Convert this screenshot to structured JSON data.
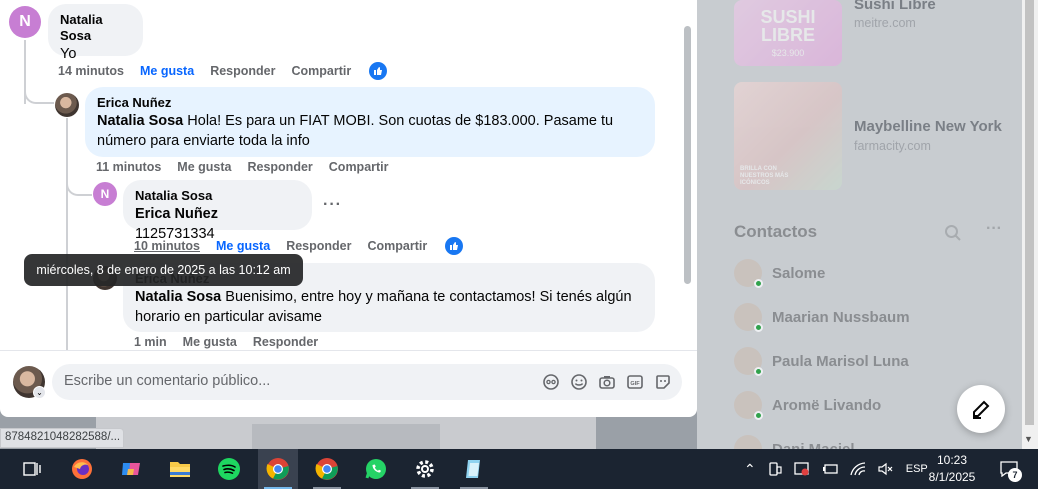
{
  "comments": [
    {
      "author": "Natalia Sosa",
      "avatar_letter": "N",
      "text": "Yo",
      "time": "14 minutos",
      "like": "Me gusta",
      "reply": "Responder",
      "share": "Compartir",
      "liked": true
    },
    {
      "author": "Erica Nuñez",
      "mention": "Natalia Sosa",
      "text": " Hola! Es para un FIAT MOBI. Son cuotas de $183.000. Pasame tu número para enviarte toda la info",
      "time": "11 minutos",
      "like": "Me gusta",
      "reply": "Responder",
      "share": "Compartir",
      "liked": false
    },
    {
      "author": "Natalia Sosa",
      "avatar_letter": "N",
      "mention": "Erica Nuñez",
      "text": " 1125731334",
      "time": "10 minutos",
      "like": "Me gusta",
      "reply": "Responder",
      "share": "Compartir",
      "liked": true,
      "more": "···"
    },
    {
      "author": "Erica Nuñez",
      "mention": "Natalia Sosa",
      "text": " Buenisimo, entre hoy y mañana te contactamos! Si tenés algún horario en particular avisame",
      "time": "1 min",
      "like": "Me gusta",
      "reply": "Responder",
      "liked": false
    }
  ],
  "tooltip": "miércoles, 8 de enero de 2025 a las 10:12 am",
  "composer": {
    "placeholder": "Escribe un comentario público..."
  },
  "status_url": "8784821048282588/...",
  "ads": [
    {
      "title": "Sushi Libre",
      "url": "meitre.com",
      "image_text": "SUSHI LIBRE",
      "image_price": "$23.900"
    },
    {
      "title": "Maybelline New York",
      "url": "farmacity.com",
      "image_caption": "BRILLA CON NUESTROS MÁS ICÓNICOS"
    }
  ],
  "contacts": {
    "title": "Contactos",
    "items": [
      "Salome",
      "Maarian Nussbaum",
      "Paula Marisol Luna",
      "Aromë Livando",
      "Dani Maciel"
    ]
  },
  "taskbar": {
    "lang": "ESP",
    "time": "10:23",
    "date": "8/1/2025",
    "notifications": "7"
  },
  "colors": {
    "accent": "#0866ff",
    "like_badge": "#1877f2",
    "reply_bubble": "#e7f3ff",
    "taskbar": "#1b2431"
  }
}
